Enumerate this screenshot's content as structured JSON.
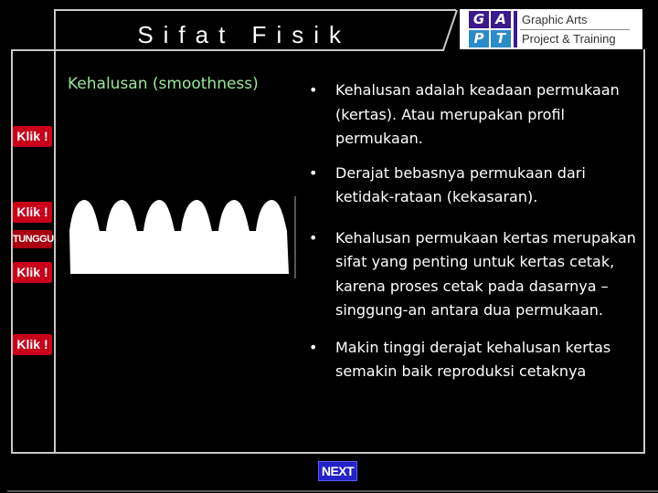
{
  "header": {
    "title": "Sifat Fisik",
    "logo": {
      "cells": [
        "G",
        "A",
        "P",
        "T"
      ],
      "line1": "Graphic Arts",
      "line2": "Project & Training",
      "colors": {
        "top": "#3a1a8c",
        "bottom": "#2a8cc8",
        "bar": "#3a1a8c"
      }
    }
  },
  "sidebar": {
    "buttons": [
      {
        "label": "Klik !",
        "type": "klik"
      },
      {
        "label": "Klik !",
        "type": "klik"
      },
      {
        "label": "TUNGGU",
        "type": "wait"
      },
      {
        "label": "Klik !",
        "type": "klik"
      },
      {
        "label": "Klik !",
        "type": "klik"
      }
    ]
  },
  "main": {
    "subtitle": "Kehalusan (smoothness)",
    "figure": {
      "description": "paper surface profile",
      "peaks": 6
    },
    "bullets": [
      "Kehalusan adalah keadaan permukaan (kertas). Atau merupakan profil permukaan.",
      "Derajat bebasnya permukaan dari ketidak-rataan (kekasaran).",
      "Kehalusan permukaan kertas merupakan sifat yang penting untuk kertas cetak, karena proses cetak pada dasarnya – singgung-an antara dua permukaan.",
      "Makin tinggi derajat kehalusan kertas semakin baik reproduksi cetaknya"
    ]
  },
  "footer": {
    "next_label": "NEXT"
  },
  "colors": {
    "accent_red": "#c8001a",
    "next_blue": "#2323c8",
    "subtitle_green": "#9ae89a"
  }
}
